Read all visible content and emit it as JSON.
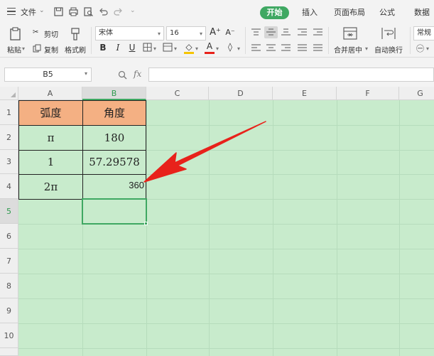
{
  "menubar": {
    "file_label": "文件",
    "tabs": [
      "开始",
      "插入",
      "页面布局",
      "公式",
      "数据"
    ]
  },
  "ribbon": {
    "paste_label": "粘贴",
    "cut_label": "剪切",
    "copy_label": "复制",
    "format_painter_label": "格式刷",
    "font_name": "宋体",
    "font_size": "16",
    "merge_center_label": "合并居中",
    "wrap_text_label": "自动换行",
    "number_format": "常规"
  },
  "formula_bar": {
    "name_box": "B5",
    "fx_label": "fx",
    "formula_value": ""
  },
  "sheet": {
    "columns": [
      "A",
      "B",
      "C",
      "D",
      "E",
      "F",
      "G"
    ],
    "rows": [
      "1",
      "2",
      "3",
      "4",
      "5",
      "6",
      "7",
      "8",
      "9",
      "10"
    ],
    "active_cell": "B5",
    "table": {
      "header_a": "弧度",
      "header_b": "角度",
      "a2": "π",
      "b2": "180",
      "a3": "1",
      "b3": "57.29578",
      "a4": "2π",
      "b4": "360"
    }
  },
  "colors": {
    "accent": "#3fa862",
    "grid_background": "#c8ebcc",
    "header_fill": "#f4b083",
    "arrow": "#e8221b"
  }
}
